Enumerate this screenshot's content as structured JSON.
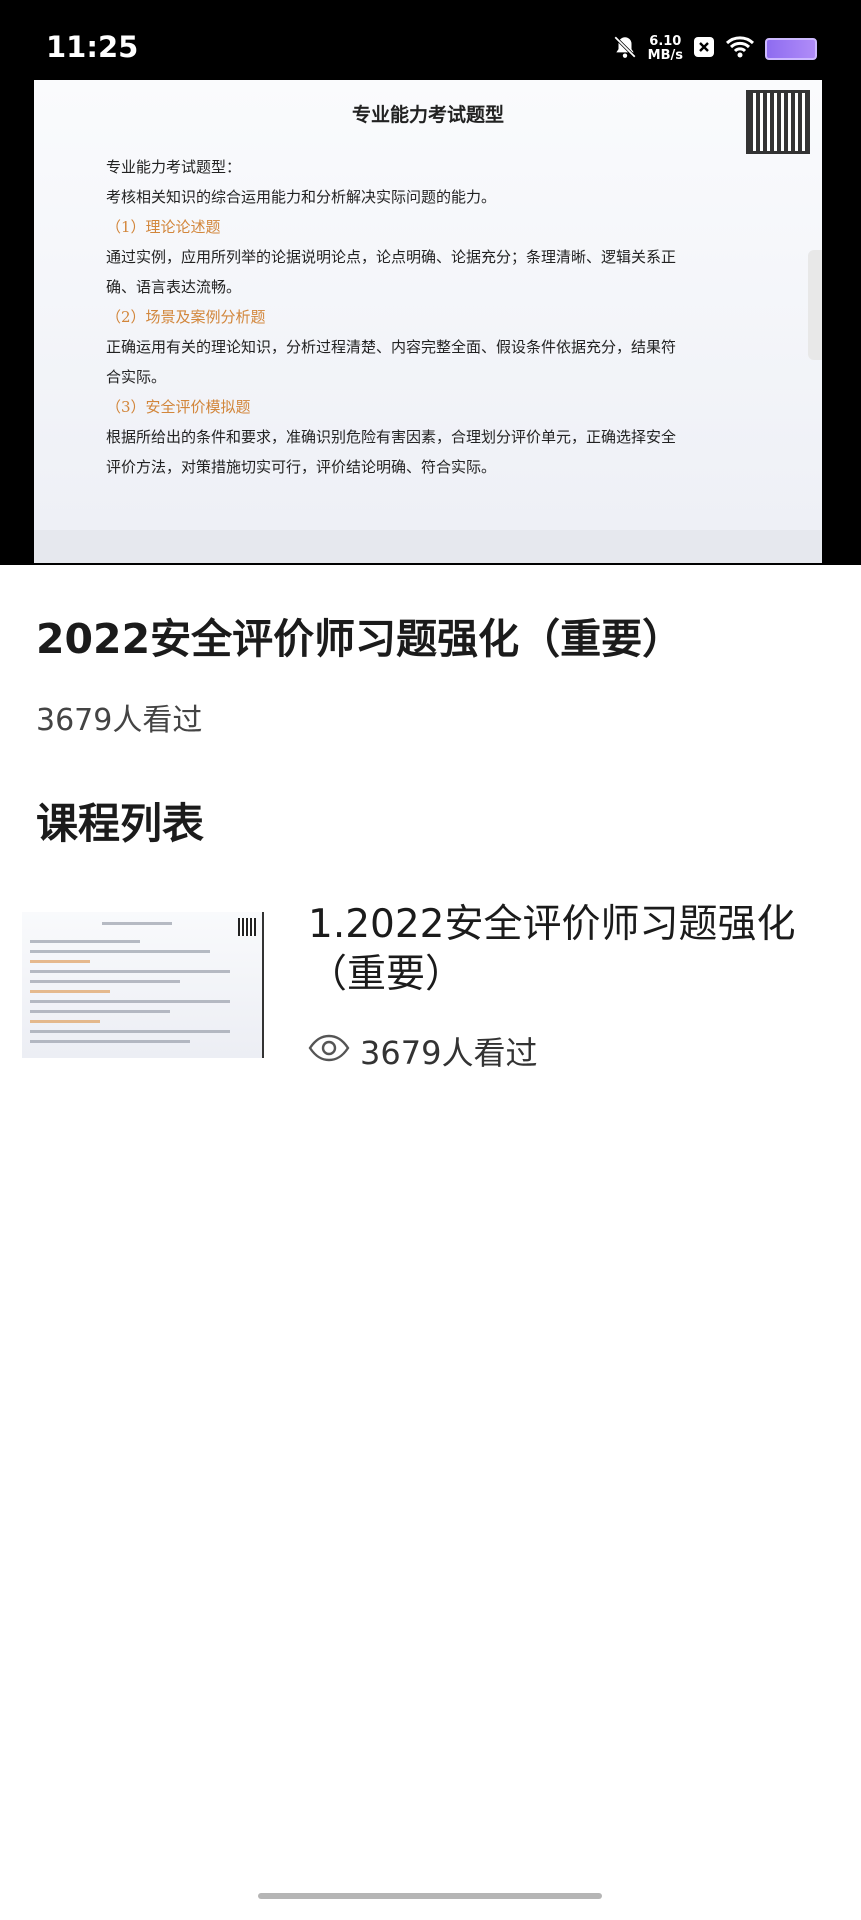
{
  "status_bar": {
    "time": "11:25",
    "net_speed_value": "6.10",
    "net_speed_unit": "MB/s",
    "icons": [
      "mute-bell-icon",
      "close-box-icon",
      "wifi-icon",
      "battery-icon"
    ],
    "battery_color": "#9b7cf4"
  },
  "video": {
    "slide_title": "专业能力考试题型",
    "lines": [
      {
        "text": "专业能力考试题型：",
        "type": "normal"
      },
      {
        "text": "考核相关知识的综合运用能力和分析解决实际问题的能力。",
        "type": "normal"
      },
      {
        "text": "（1）理论论述题",
        "type": "heading"
      },
      {
        "text": "通过实例，应用所列举的论据说明论点，论点明确、论据充分；条理清晰、逻辑关系正",
        "type": "normal"
      },
      {
        "text": "确、语言表达流畅。",
        "type": "normal"
      },
      {
        "text": "（2）场景及案例分析题",
        "type": "heading"
      },
      {
        "text": "正确运用有关的理论知识，分析过程清楚、内容完整全面、假设条件依据充分，结果符",
        "type": "normal"
      },
      {
        "text": "合实际。",
        "type": "normal"
      },
      {
        "text": "（3）安全评价模拟题",
        "type": "heading"
      },
      {
        "text": "根据所给出的条件和要求，准确识别危险有害因素，合理划分评价单元，正确选择安全",
        "type": "normal"
      },
      {
        "text": "评价方法，对策措施切实可行，评价结论明确、符合实际。",
        "type": "normal"
      }
    ],
    "heading_color": "#d2863b"
  },
  "course": {
    "title": "2022安全评价师习题强化（重要）",
    "views": "3679人看过"
  },
  "section": {
    "title": "课程列表"
  },
  "lessons": [
    {
      "title": "1.2022安全评价师习题强化（重要）",
      "views": "3679人看过",
      "icon": "eye-icon"
    }
  ]
}
